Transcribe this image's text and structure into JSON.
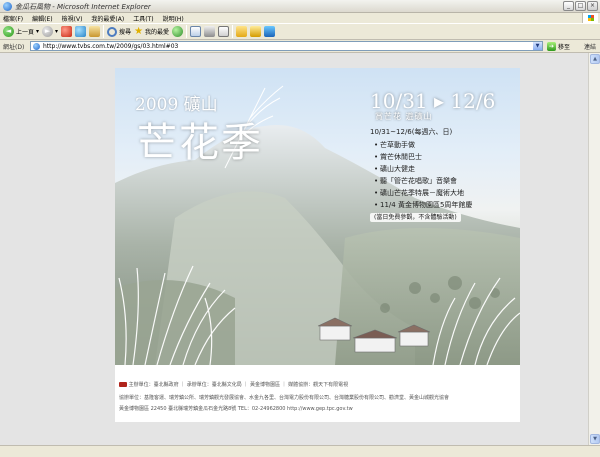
{
  "window": {
    "title": "金瓜石風物 - Microsoft Internet Explorer",
    "min": "_",
    "max": "□",
    "close": "×"
  },
  "menu": [
    "檔案(F)",
    "編輯(E)",
    "檢視(V)",
    "我的最愛(A)",
    "工具(T)",
    "說明(H)"
  ],
  "toolbar": {
    "back_label": "上一頁",
    "search_label": "搜尋",
    "favorites_label": "我的最愛"
  },
  "address": {
    "label": "網址(D)",
    "url": "http://www.tvbs.com.tw/2009/gs/03.html#03",
    "go_label": "移至",
    "links_label": "連結"
  },
  "poster": {
    "year": "2009 礦山",
    "title": "芒花季",
    "dates": "10/31 ▸ 12/6",
    "subtitle": "賞芒花 遊礦山",
    "schedule_period": "10/31~12/6(每週六、日)",
    "items": [
      "芒草動手做",
      "賞芒休閒巴士",
      "礦山大健走",
      "聽「管芒花唱歌」音樂會",
      "礦山芒花季特展－魔術大地",
      "11/4 黃金博物園區5周年館慶"
    ],
    "note": "(當日免費參觀，不含體驗活動)"
  },
  "footer": {
    "line1": "主辦單位：臺北縣政府  ｜  承辦單位：臺北縣文化局  ｜  黃金博物園區  ｜  媒體協辦：觀天下有限電視",
    "line2": "協辦單位：基隆客運、瑞芳鎮公所、瑞芳鎮觀光發展協會、水金九各里、台灣電力股份有限公司、台灣糖業股份有限公司、勸濟堂、黃金山城觀光協會",
    "line3": "黃金博物園區   22450 臺北縣瑞芳鎮金瓜石金光路8號   TEL：02-24962800   http://www.gep.tpc.gov.tw"
  },
  "icons": {
    "back": "back-arrow-icon",
    "forward": "forward-arrow-icon",
    "stop": "stop-icon",
    "refresh": "refresh-icon",
    "home": "home-icon",
    "search": "search-icon",
    "favorites": "star-icon",
    "history": "history-icon",
    "mail": "mail-icon",
    "print": "print-icon",
    "edit": "edit-icon",
    "folder": "folder-icon",
    "book": "book-icon",
    "messenger": "messenger-icon"
  }
}
